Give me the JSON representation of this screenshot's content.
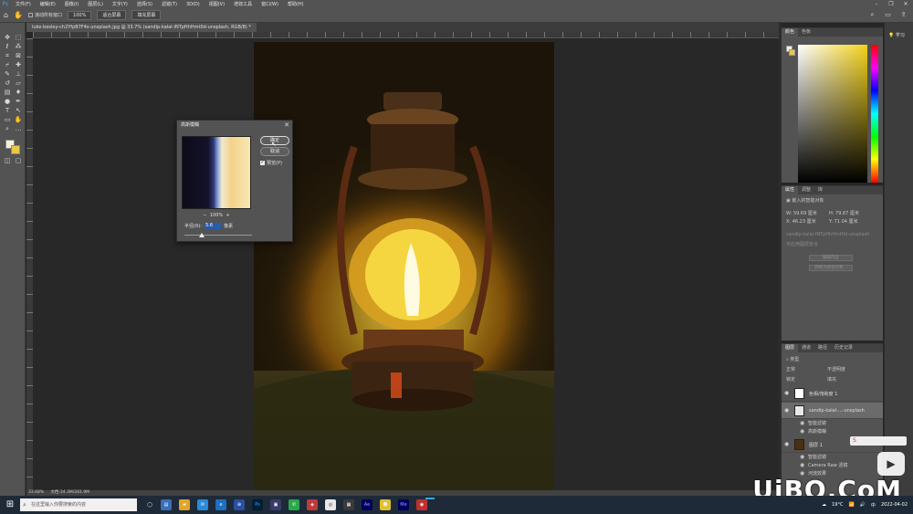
{
  "menubar": {
    "app_icon": "Ps",
    "items": [
      "文件(F)",
      "编辑(E)",
      "图像(I)",
      "图层(L)",
      "文字(Y)",
      "选择(S)",
      "滤镜(T)",
      "3D(D)",
      "视图(V)",
      "增效工具",
      "窗口(W)",
      "帮助(H)"
    ]
  },
  "optionsbar": {
    "scroll_all_label": "滚动所有窗口",
    "zoom_value": "100%",
    "fit_screen_label": "适合屏幕",
    "fill_screen_label": "填充屏幕"
  },
  "document": {
    "tab_title": "luke-besley-ch2YfpB7F4s-unsplash.jpg @ 33.7% (sandip-kalal-INTpHhHmt0d-unsplash, RGB/8) *",
    "zoom": "33.68%",
    "doc_info": "文档:34.3M/281.9M"
  },
  "blur_dialog": {
    "title": "高斯模糊",
    "ok_label": "确定",
    "cancel_label": "取消",
    "preview_label": "预览(P)",
    "preview_checked": "✓",
    "zoom_out": "−",
    "zoom_value": "100%",
    "zoom_in": "+",
    "radius_label": "半径(R):",
    "radius_value": "5.6",
    "radius_unit": "像素",
    "radius_slider_fraction": 0.25
  },
  "color_panel": {
    "tabs": [
      "颜色",
      "色板"
    ],
    "foreground": "#f5f0d8",
    "background": "#e6c84a",
    "hue": "#f4d21b"
  },
  "properties_panel": {
    "tabs": [
      "属性",
      "调整",
      "库"
    ],
    "type_label": "嵌入的智能对象",
    "w_label": "W:",
    "w_value": "59.69 厘米",
    "h_label": "H:",
    "h_value": "79.67 厘米",
    "x_label": "X:",
    "x_value": "46.23 厘米",
    "y_label": "Y:",
    "y_value": "71.04 厘米",
    "file_name": "sandip-kalal-INTpHhHmt0d-unsplash",
    "layer_comp": "不应用图层复合",
    "edit_contents_label": "编辑内容",
    "convert_label": "转换为链接对象..."
  },
  "layers_panel": {
    "tabs": [
      "图层",
      "通道",
      "路径",
      "历史记录"
    ],
    "kind_label": "类型",
    "blend_mode": "正常",
    "opacity": "不透明度",
    "lock_label": "锁定",
    "fill_label": "填充",
    "layers": [
      {
        "name": "色相/饱和度 1",
        "type": "adjustment"
      },
      {
        "name": "sandip-kalal-...-unsplash",
        "type": "smart",
        "selected": true
      },
      {
        "name": "智能滤镜",
        "type": "sub"
      },
      {
        "name": "高斯模糊",
        "type": "sub"
      },
      {
        "name": "图层 1",
        "type": "smart"
      },
      {
        "name": "智能滤镜",
        "type": "sub"
      },
      {
        "name": "Camera Raw 滤镜",
        "type": "sub"
      },
      {
        "name": "河流效果",
        "type": "sub"
      }
    ]
  },
  "learn_panel": {
    "label": "学习"
  },
  "taskbar": {
    "search_placeholder": "在这里输入你要搜索的内容",
    "apps": [
      "Ps",
      "Ae",
      "Me",
      "Lr"
    ],
    "temperature": "19°C",
    "ime": "中",
    "time": "",
    "date": "2022-04-02"
  },
  "watermark": "UiBQ.CoM",
  "ime_badge": "S"
}
